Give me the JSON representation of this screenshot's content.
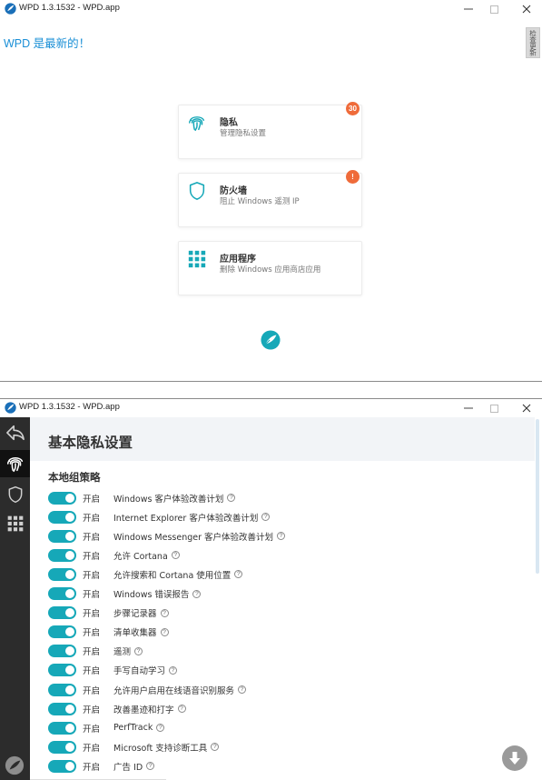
{
  "window1": {
    "title": "WPD 1.3.1532 - WPD.app",
    "status_text": "WPD 是最新的！",
    "update_tab": "检查更新",
    "cards": [
      {
        "title": "隐私",
        "subtitle": "管理隐私设置",
        "badge": "30",
        "icon": "fingerprint-icon"
      },
      {
        "title": "防火墙",
        "subtitle": "阻止 Windows 遥测 IP",
        "badge": "!",
        "icon": "shield-icon"
      },
      {
        "title": "应用程序",
        "subtitle": "删除 Windows 应用商店应用",
        "badge": "",
        "icon": "apps-grid-icon"
      }
    ]
  },
  "window2": {
    "title": "WPD 1.3.1532 - WPD.app",
    "page_title": "基本隐私设置",
    "section_title": "本地组策略",
    "state_on": "开启",
    "rows": [
      {
        "label": "Windows 客户体验改善计划",
        "on": true
      },
      {
        "label": "Internet Explorer 客户体验改善计划",
        "on": true
      },
      {
        "label": "Windows Messenger 客户体验改善计划",
        "on": true
      },
      {
        "label": "允许 Cortana",
        "on": true
      },
      {
        "label": "允许搜索和 Cortana 使用位置",
        "on": true
      },
      {
        "label": "Windows 错误报告",
        "on": true
      },
      {
        "label": "步骤记录器",
        "on": true
      },
      {
        "label": "清单收集器",
        "on": true
      },
      {
        "label": "遥测",
        "on": true
      },
      {
        "label": "手写自动学习",
        "on": true
      },
      {
        "label": "允许用户启用在线语音识别服务",
        "on": true
      },
      {
        "label": "改善墨迹和打字",
        "on": true
      },
      {
        "label": "PerfTrack",
        "on": true
      },
      {
        "label": "Microsoft 支持诊断工具",
        "on": true
      },
      {
        "label": "广告 ID",
        "on": true
      }
    ]
  },
  "colors": {
    "accent_teal": "#16a8b8",
    "link_blue": "#1a8fd6",
    "badge_orange": "#ef6b3a",
    "sidebar_dark": "#2c2c2c"
  }
}
